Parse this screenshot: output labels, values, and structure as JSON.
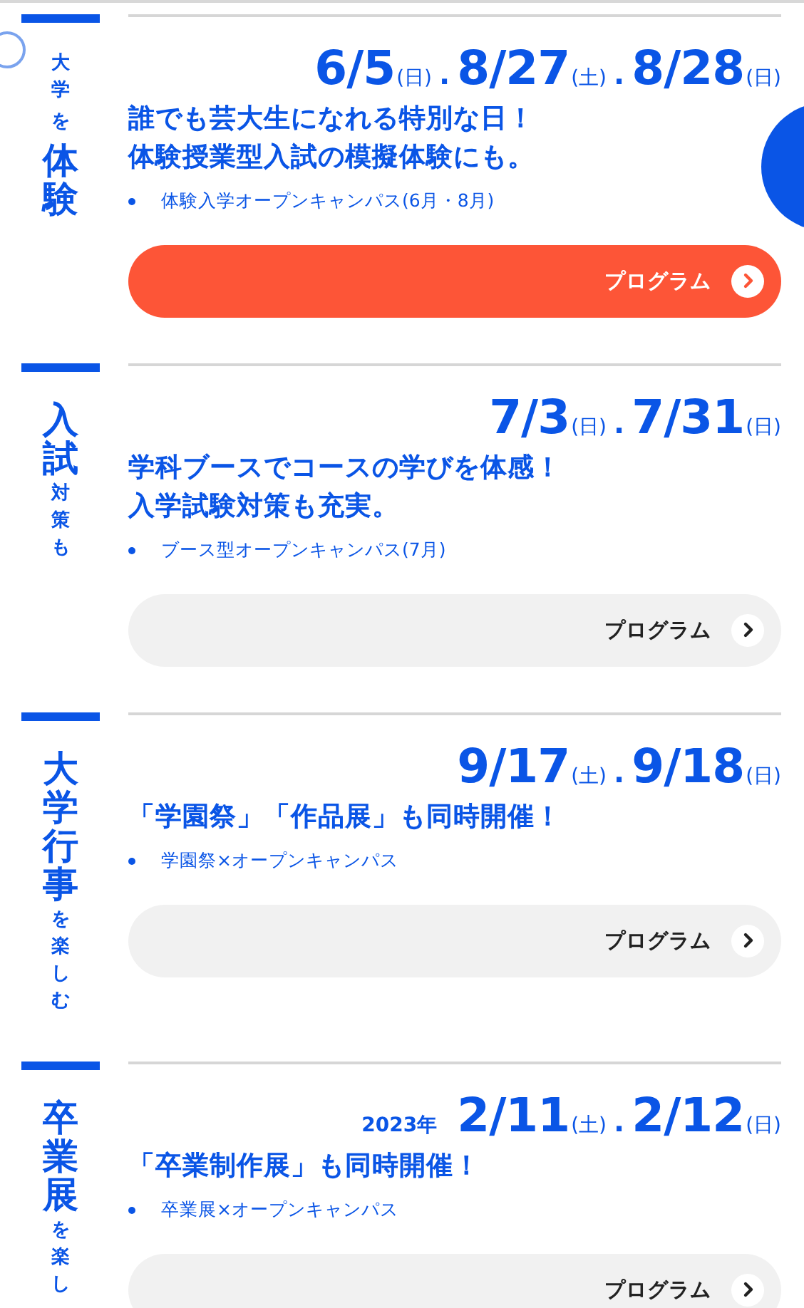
{
  "sections": [
    {
      "label": [
        {
          "text": "大学",
          "kind": "small"
        },
        {
          "text": "を",
          "kind": "small"
        },
        {
          "text": "体験",
          "kind": "large"
        }
      ],
      "dates": [
        {
          "kind": "date",
          "text": "6/5"
        },
        {
          "kind": "weekday",
          "text": "(日)"
        },
        {
          "kind": "sep",
          "text": "."
        },
        {
          "kind": "date",
          "text": "8/27"
        },
        {
          "kind": "weekday",
          "text": "(土)"
        },
        {
          "kind": "sep",
          "text": "."
        },
        {
          "kind": "date",
          "text": "8/28"
        },
        {
          "kind": "weekday",
          "text": "(日)"
        }
      ],
      "headline": [
        "誰でも芸大生になれる特別な日！",
        "体験授業型入試の模擬体験にも。"
      ],
      "items": [
        "体験入学オープンキャンパス(6月・8月)"
      ],
      "button": {
        "label": "プログラム",
        "highlighted": true
      }
    },
    {
      "label": [
        {
          "text": "入試",
          "kind": "large"
        },
        {
          "text": "対策も",
          "kind": "small"
        }
      ],
      "dates": [
        {
          "kind": "date",
          "text": "7/3"
        },
        {
          "kind": "weekday",
          "text": "(日)"
        },
        {
          "kind": "sep",
          "text": "."
        },
        {
          "kind": "date",
          "text": "7/31"
        },
        {
          "kind": "weekday",
          "text": "(日)"
        }
      ],
      "headline": [
        "学科ブースでコースの学びを体感！",
        "入学試験対策も充実。"
      ],
      "items": [
        "ブース型オープンキャンパス(7月)"
      ],
      "button": {
        "label": "プログラム",
        "highlighted": false
      }
    },
    {
      "label": [
        {
          "text": "大学行事",
          "kind": "large"
        },
        {
          "text": "を楽しむ",
          "kind": "small"
        }
      ],
      "dates": [
        {
          "kind": "date",
          "text": "9/17"
        },
        {
          "kind": "weekday",
          "text": "(土)"
        },
        {
          "kind": "sep",
          "text": "."
        },
        {
          "kind": "date",
          "text": "9/18"
        },
        {
          "kind": "weekday",
          "text": "(日)"
        }
      ],
      "headline": [
        "「学園祭」「作品展」も同時開催！"
      ],
      "items": [
        "学園祭×オープンキャンパス"
      ],
      "button": {
        "label": "プログラム",
        "highlighted": false
      }
    },
    {
      "label": [
        {
          "text": "卒業展",
          "kind": "large"
        },
        {
          "text": "を楽し",
          "kind": "small"
        }
      ],
      "dates": [
        {
          "kind": "year",
          "text": "2023年"
        },
        {
          "kind": "date",
          "text": "2/11"
        },
        {
          "kind": "weekday",
          "text": "(土)"
        },
        {
          "kind": "sep",
          "text": "."
        },
        {
          "kind": "date",
          "text": "2/12"
        },
        {
          "kind": "weekday",
          "text": "(日)"
        }
      ],
      "headline": [
        "「卒業制作展」も同時開催！"
      ],
      "items": [
        "卒業展×オープンキャンパス"
      ],
      "button": {
        "label": "プログラム",
        "highlighted": false
      }
    }
  ]
}
